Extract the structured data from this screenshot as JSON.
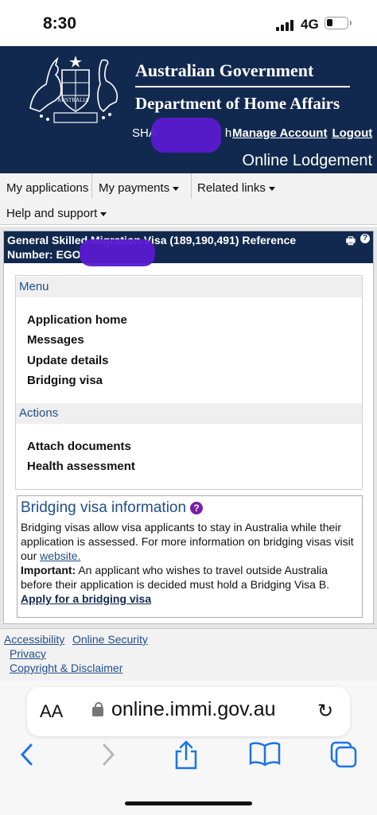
{
  "status_bar": {
    "time": "8:30",
    "network": "4G"
  },
  "header": {
    "agency_line1": "Australian Government",
    "agency_line2": "Department of Home Affairs",
    "user_name_visible": "SHA",
    "user_name_tail": "h",
    "manage_account": "Manage Account",
    "logout": "Logout",
    "portal_name": "Online Lodgement",
    "crest_label": "AUSTRALIA"
  },
  "nav": {
    "my_applications": "My applications",
    "my_payments": "My payments",
    "related_links": "Related links",
    "help_support": "Help and support"
  },
  "panel": {
    "title": "General Skilled Migration Visa (189,190,491) Reference Number: EGO",
    "menu_heading": "Menu",
    "menu_items": [
      "Application home",
      "Messages",
      "Update details",
      "Bridging visa"
    ],
    "actions_heading": "Actions",
    "action_items": [
      "Attach documents",
      "Health assessment"
    ],
    "bridging": {
      "title": "Bridging visa information",
      "text1": "Bridging visas allow visa applicants to stay in Australia while their application is assessed. For more information on bridging visas visit our ",
      "link_website": "website.",
      "important_label": "Important:",
      "important_text": " An applicant who wishes to travel outside Australia before their application is decided must hold a Bridging Visa B.",
      "apply_link": "Apply for a bridging visa"
    }
  },
  "footer": {
    "accessibility": "Accessibility",
    "online_security": "Online Security",
    "privacy": "Privacy",
    "copyright": "Copyright & Disclaimer"
  },
  "browser": {
    "text_size": "AA",
    "url": "online.immi.gov.au"
  },
  "colors": {
    "header_navy": "#12294f",
    "link_blue": "#1f4e8c",
    "help_purple": "#7a1fa6",
    "redaction": "#5a1ad0",
    "ios_blue": "#1a73e8"
  }
}
